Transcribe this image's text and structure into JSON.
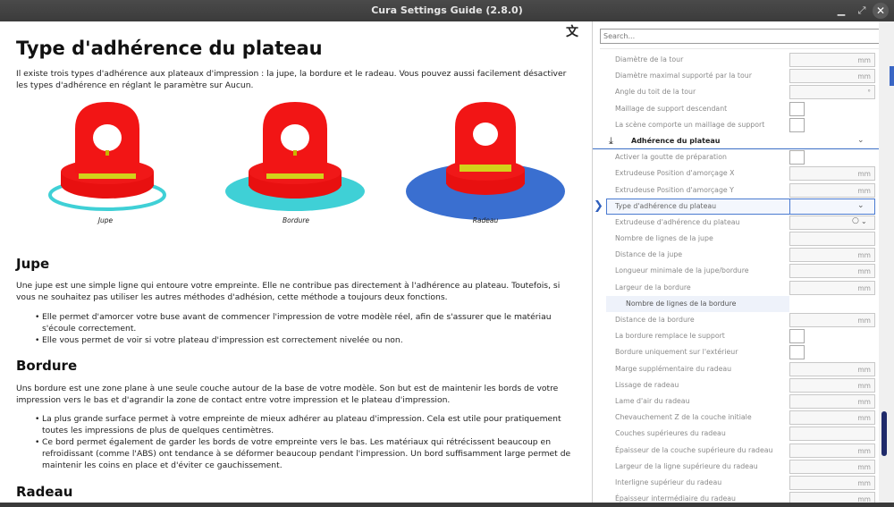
{
  "window": {
    "title": "Cura Settings Guide (2.8.0)"
  },
  "doc": {
    "title": "Type d'adhérence du plateau",
    "intro": "Il existe trois types d'adhérence aux plateaux d'impression : la jupe, la bordure et le radeau. Vous pouvez aussi facilement désactiver les types d'adhérence en réglant le paramètre sur Aucun.",
    "figures": [
      {
        "caption": "Jupe",
        "base_color": "#3fd0d6"
      },
      {
        "caption": "Bordure",
        "base_color": "#3fd0d6"
      },
      {
        "caption": "Radeau",
        "base_color": "#3a6fd0"
      }
    ],
    "sections": [
      {
        "heading": "Jupe",
        "text": "Une jupe est une simple ligne qui entoure votre empreinte. Elle ne contribue pas directement à l'adhérence au plateau. Toutefois, si vous ne souhaitez pas utiliser les autres méthodes d'adhésion, cette méthode a toujours deux fonctions.",
        "bullets": [
          "Elle permet d'amorcer votre buse avant de commencer l'impression de votre modèle réel, afin de s'assurer que le matériau s'écoule correctement.",
          "Elle vous permet de voir si votre plateau d'impression est correctement nivelée ou non."
        ]
      },
      {
        "heading": "Bordure",
        "text": "Uns bordure est une zone plane à une seule couche autour de la base de votre modèle. Son but est de maintenir les bords de votre impression vers le bas et d'agrandir la zone de contact entre votre impression et le plateau d'impression.",
        "bullets": [
          "La plus grande surface permet à votre empreinte de mieux adhérer au plateau d'impression. Cela est utile pour pratiquement toutes les impressions de plus de quelques centimètres.",
          "Ce bord permet également de garder les bords de votre empreinte vers le bas. Les matériaux qui rétrécissent beaucoup en refroidissant (comme l'ABS) ont tendance à se déformer beaucoup pendant l'impression. Un bord suffisamment large permet de maintenir les coins en place et d'éviter ce gauchissement."
        ]
      },
      {
        "heading": "Radeau"
      }
    ]
  },
  "settings": {
    "search_placeholder": "Search...",
    "rows": [
      {
        "type": "input",
        "label": "Diamètre de la tour",
        "unit": "mm"
      },
      {
        "type": "input",
        "label": "Diamètre maximal supporté par la tour",
        "unit": "mm"
      },
      {
        "type": "input",
        "label": "Angle du toit de la tour",
        "unit": "°"
      },
      {
        "type": "check",
        "label": "Maillage de support descendant"
      },
      {
        "type": "check",
        "label": "La scène comporte un maillage de support"
      },
      {
        "type": "section",
        "label": "Adhérence du plateau"
      },
      {
        "type": "check",
        "label": "Activer la goutte de préparation"
      },
      {
        "type": "input",
        "label": "Extrudeuse Position d'amorçage X",
        "unit": "mm"
      },
      {
        "type": "input",
        "label": "Extrudeuse Position d'amorçage Y",
        "unit": "mm"
      },
      {
        "type": "highlight",
        "label": "Type d'adhérence du plateau"
      },
      {
        "type": "dropdown",
        "label": "Extrudeuse d'adhérence du plateau"
      },
      {
        "type": "input",
        "label": "Nombre de lignes de la jupe",
        "unit": ""
      },
      {
        "type": "input",
        "label": "Distance de la jupe",
        "unit": "mm"
      },
      {
        "type": "input",
        "label": "Longueur minimale de la jupe/bordure",
        "unit": "mm"
      },
      {
        "type": "input",
        "label": "Largeur de la bordure",
        "unit": "mm"
      },
      {
        "type": "sub",
        "label": "Nombre de lignes de la bordure"
      },
      {
        "type": "input",
        "label": "Distance de la bordure",
        "unit": "mm"
      },
      {
        "type": "check",
        "label": "La bordure remplace le support"
      },
      {
        "type": "check",
        "label": "Bordure uniquement sur l'extérieur"
      },
      {
        "type": "input",
        "label": "Marge supplémentaire du radeau",
        "unit": "mm"
      },
      {
        "type": "input",
        "label": "Lissage de radeau",
        "unit": "mm"
      },
      {
        "type": "input",
        "label": "Lame d'air du radeau",
        "unit": "mm"
      },
      {
        "type": "input",
        "label": "Chevauchement Z de la couche initiale",
        "unit": "mm"
      },
      {
        "type": "input",
        "label": "Couches supérieures du radeau",
        "unit": ""
      },
      {
        "type": "input",
        "label": "Épaisseur de la couche supérieure du radeau",
        "unit": "mm"
      },
      {
        "type": "input",
        "label": "Largeur de la ligne supérieure du radeau",
        "unit": "mm"
      },
      {
        "type": "input",
        "label": "Interligne supérieur du radeau",
        "unit": "mm"
      },
      {
        "type": "input",
        "label": "Épaisseur intermédiaire du radeau",
        "unit": "mm"
      }
    ]
  }
}
